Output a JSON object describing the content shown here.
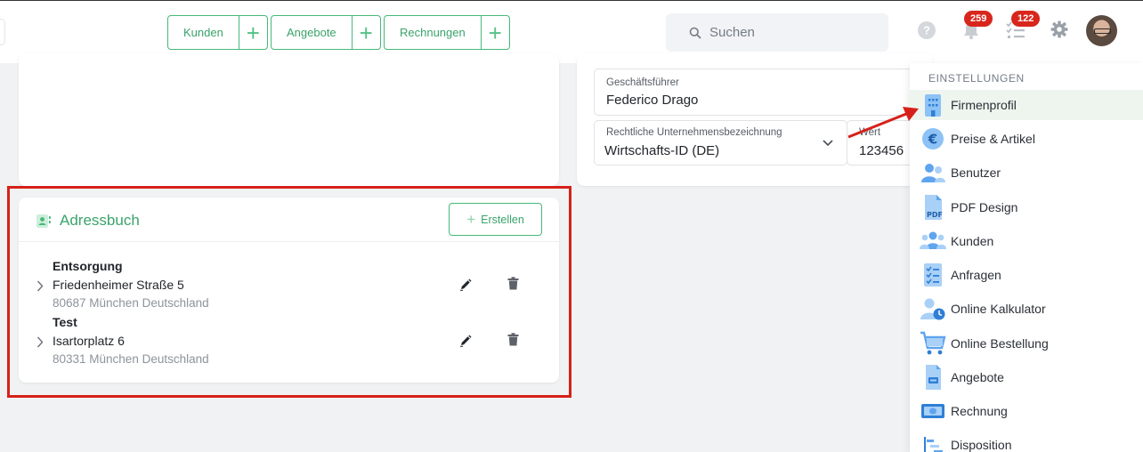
{
  "topbar": {
    "quick_links": [
      {
        "label": "Kunden"
      },
      {
        "label": "Angebote"
      },
      {
        "label": "Rechnungen"
      }
    ],
    "search_placeholder": "Suchen",
    "notifications_count": "259",
    "tasks_count": "122"
  },
  "company": {
    "manager_label": "Geschäftsführer",
    "manager_value": "Federico Drago",
    "legal_label": "Rechtliche Unternehmensbezeichnung",
    "legal_value": "Wirtschafts-ID (DE)",
    "value_label": "Wert",
    "value_value": "123456"
  },
  "address_book": {
    "title": "Adressbuch",
    "create_label": "Erstellen",
    "entries": [
      {
        "name": "Entsorgung",
        "street": "Friedenheimer Straße 5",
        "city": "80687 München Deutschland"
      },
      {
        "name": "Test",
        "street": "Isartorplatz 6",
        "city": "80331 München Deutschland"
      }
    ]
  },
  "settings_menu": {
    "heading": "EINSTELLUNGEN",
    "items": [
      {
        "label": "Firmenprofil",
        "icon": "building-icon"
      },
      {
        "label": "Preise & Artikel",
        "icon": "euro-icon"
      },
      {
        "label": "Benutzer",
        "icon": "users-icon"
      },
      {
        "label": "PDF Design",
        "icon": "pdf-icon"
      },
      {
        "label": "Kunden",
        "icon": "customers-icon"
      },
      {
        "label": "Anfragen",
        "icon": "checklist-icon"
      },
      {
        "label": "Online Kalkulator",
        "icon": "user-clock-icon"
      },
      {
        "label": "Online Bestellung",
        "icon": "cart-icon"
      },
      {
        "label": "Angebote",
        "icon": "offer-document-icon"
      },
      {
        "label": "Rechnung",
        "icon": "money-icon"
      },
      {
        "label": "Disposition",
        "icon": "gantt-icon"
      }
    ]
  },
  "colors": {
    "accent": "#3aa36b",
    "highlight": "#d6211a",
    "badge": "#d8261c",
    "menu_icon": "#6aaef2"
  }
}
